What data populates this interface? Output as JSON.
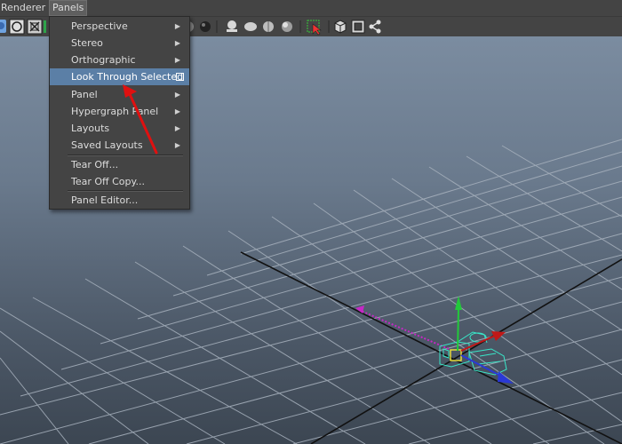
{
  "menubar": {
    "items": [
      {
        "label": "Renderer"
      },
      {
        "label": "Panels"
      }
    ]
  },
  "toolbar": {
    "icons": [
      "wireframe-icon",
      "smooth-shade-icon",
      "xray-icon",
      "sphere-icon",
      "shaded-sphere-icon",
      "light-icon",
      "ao-icon",
      "texture-icon",
      "shadow-icon",
      "select-icon",
      "isolate-icon",
      "frame-icon",
      "share-icon"
    ]
  },
  "panels_menu": {
    "items": [
      {
        "label": "Perspective",
        "submenu": true
      },
      {
        "label": "Stereo",
        "submenu": true
      },
      {
        "label": "Orthographic",
        "submenu": true
      },
      {
        "label": "Look Through Selected",
        "highlighted": true,
        "option_box": true
      },
      {
        "label": "Panel",
        "submenu": true
      },
      {
        "label": "Hypergraph Panel",
        "submenu": true
      },
      {
        "label": "Layouts",
        "submenu": true
      },
      {
        "label": "Saved Layouts",
        "submenu": true
      },
      {
        "label": "Tear Off..."
      },
      {
        "label": "Tear Off Copy..."
      },
      {
        "label": "Panel Editor..."
      }
    ]
  },
  "colors": {
    "highlight": "#5b7fa6",
    "annotation_arrow": "#e01010",
    "camera_wire": "#39e6c8",
    "axis_y": "#22c93a",
    "axis_z": "#2a39d6",
    "axis_x": "#c01818",
    "view_axis": "#c628c6"
  },
  "icons": {
    "submenu": "triangle-right-icon",
    "option": "option-box-icon"
  }
}
